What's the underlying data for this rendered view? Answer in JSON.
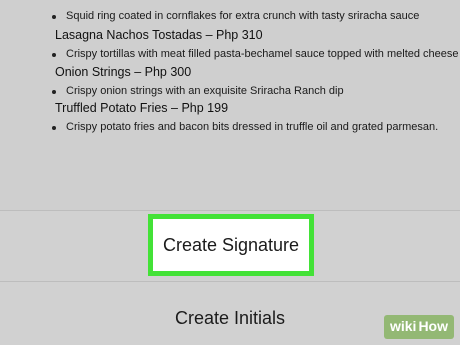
{
  "document": {
    "items": [
      {
        "title": "",
        "desc": "Squid ring coated in cornflakes for extra crunch with tasty sriracha sauce"
      },
      {
        "title": "Lasagna Nachos Tostadas – Php 310",
        "desc": "Crispy tortillas with meat filled pasta-bechamel sauce topped with melted cheese"
      },
      {
        "title": "Onion Strings – Php 300",
        "desc": "Crispy onion strings with an exquisite Sriracha Ranch dip"
      },
      {
        "title": "Truffled Potato Fries – Php 199",
        "desc": "Crispy potato fries and bacon bits dressed in truffle oil and grated parmesan."
      }
    ]
  },
  "sheet": {
    "create_signature": "Create Signature",
    "create_initials": "Create Initials"
  },
  "watermark": {
    "part1": "wiki",
    "part2": "How"
  },
  "colors": {
    "highlight_border": "#43e237",
    "watermark_bg": "#93b874"
  }
}
